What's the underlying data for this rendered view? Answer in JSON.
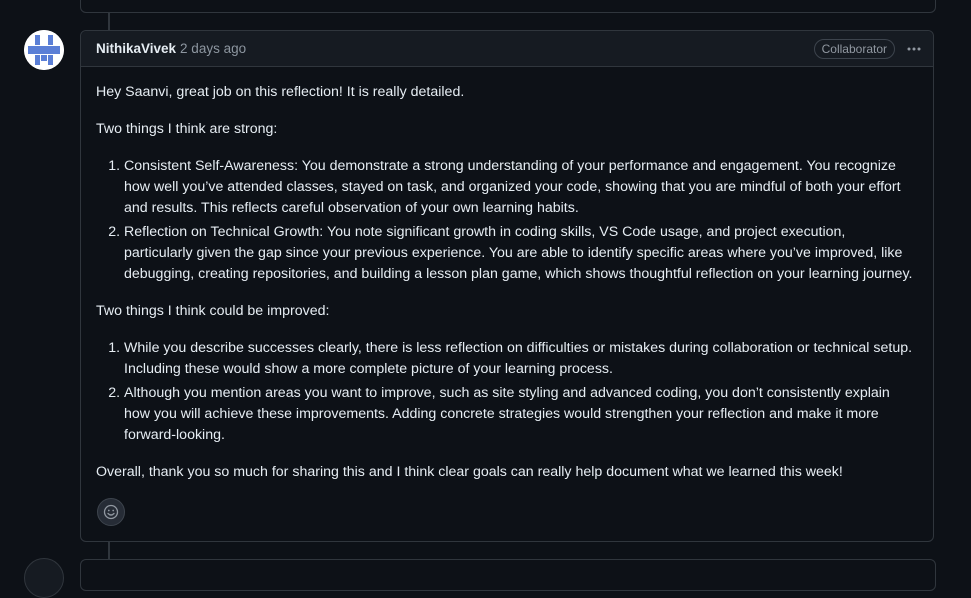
{
  "comment": {
    "author": "NithikaVivek",
    "timestamp": "2 days ago",
    "role_badge": "Collaborator",
    "more_icon": "kebab-horizontal-icon",
    "avatar_icon": "identicon-avatar",
    "reaction_icon": "smiley-icon",
    "greeting": "Hey Saanvi, great job on this reflection! It is really detailed.",
    "strengths_heading": "Two things I think are strong:",
    "strengths": [
      "Consistent Self-Awareness: You demonstrate a strong understanding of your performance and engagement. You recognize how well you’ve attended classes, stayed on task, and organized your code, showing that you are mindful of both your effort and results. This reflects careful observation of your own learning habits.",
      "Reflection on Technical Growth: You note significant growth in coding skills, VS Code usage, and project execution, particularly given the gap since your previous experience. You are able to identify specific areas where you’ve improved, like debugging, creating repositories, and building a lesson plan game, which shows thoughtful reflection on your learning journey."
    ],
    "improvements_heading": "Two things I think could be improved:",
    "improvements": [
      "While you describe successes clearly, there is less reflection on difficulties or mistakes during collaboration or technical setup. Including these would show a more complete picture of your learning process.",
      "Although you mention areas you want to improve, such as site styling and advanced coding, you don’t consistently explain how you will achieve these improvements. Adding concrete strategies would strengthen your reflection and make it more forward-looking."
    ],
    "closing": "Overall, thank you so much for sharing this and I think clear goals can really help document what we learned this week!"
  },
  "colors": {
    "background": "#0d1117",
    "header_background": "#161b22",
    "border": "#30363d",
    "text": "#e6edf3",
    "muted_text": "#8d96a0",
    "avatar_accent": "#5b7fd6"
  }
}
